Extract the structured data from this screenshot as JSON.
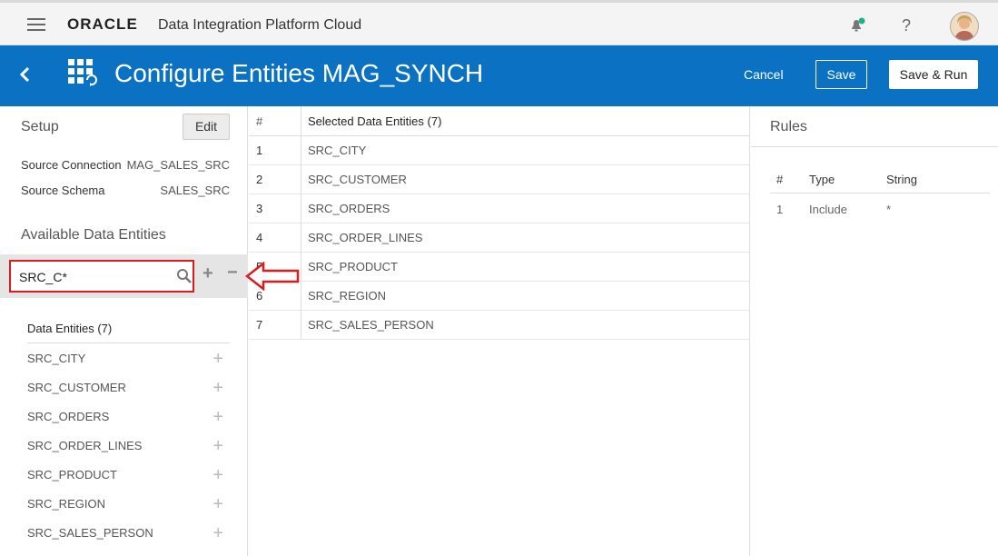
{
  "topbar": {
    "logo": "ORACLE",
    "product": "Data Integration Platform Cloud",
    "help_label": "?"
  },
  "header": {
    "title": "Configure Entities MAG_SYNCH",
    "cancel": "Cancel",
    "save": "Save",
    "save_run": "Save & Run"
  },
  "setup": {
    "title": "Setup",
    "edit": "Edit",
    "source_connection_label": "Source Connection",
    "source_connection_value": "MAG_SALES_SRC",
    "source_schema_label": "Source Schema",
    "source_schema_value": "SALES_SRC"
  },
  "available": {
    "title": "Available Data Entities",
    "search_value": "SRC_C*",
    "list_header": "Data Entities (7)",
    "items": [
      "SRC_CITY",
      "SRC_CUSTOMER",
      "SRC_ORDERS",
      "SRC_ORDER_LINES",
      "SRC_PRODUCT",
      "SRC_REGION",
      "SRC_SALES_PERSON"
    ]
  },
  "selected": {
    "col_num": "#",
    "col_name": "Selected Data Entities (7)",
    "rows": [
      {
        "n": "1",
        "name": "SRC_CITY"
      },
      {
        "n": "2",
        "name": "SRC_CUSTOMER"
      },
      {
        "n": "3",
        "name": "SRC_ORDERS"
      },
      {
        "n": "4",
        "name": "SRC_ORDER_LINES"
      },
      {
        "n": "5",
        "name": "SRC_PRODUCT"
      },
      {
        "n": "6",
        "name": "SRC_REGION"
      },
      {
        "n": "7",
        "name": "SRC_SALES_PERSON"
      }
    ]
  },
  "rules": {
    "title": "Rules",
    "col_num": "#",
    "col_type": "Type",
    "col_string": "String",
    "rows": [
      {
        "n": "1",
        "type": "Include",
        "string": "*"
      }
    ]
  },
  "colors": {
    "brand_blue": "#0b72c3",
    "highlight_red": "#e01a1a",
    "notification_green": "#1fb28a"
  }
}
